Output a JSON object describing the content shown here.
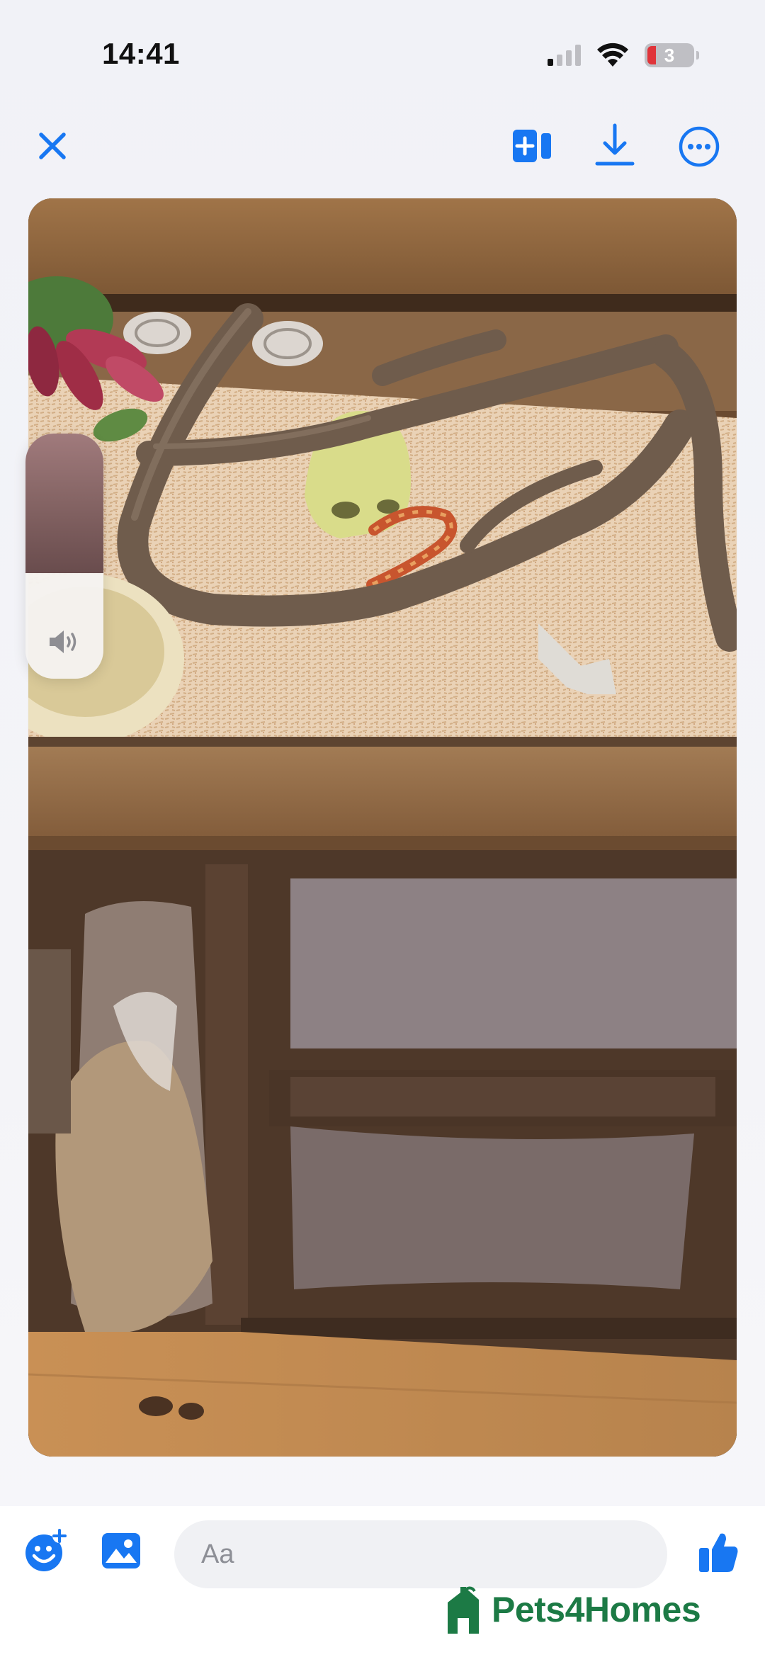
{
  "status_bar": {
    "time": "14:41",
    "battery_level": "3",
    "icons": [
      "cellular-signal-icon",
      "wifi-icon",
      "battery-icon"
    ]
  },
  "top_nav": {
    "icons": [
      "close-icon",
      "add-to-album-icon",
      "download-icon",
      "more-options-icon"
    ]
  },
  "media": {
    "volume_level": 0.57,
    "volume_icon": "speaker-icon"
  },
  "composer": {
    "placeholder": "Aa",
    "icons": [
      "add-emoji-effect-icon",
      "photo-library-icon",
      "thumbs-up-icon"
    ]
  },
  "watermark": {
    "text": "Pets4Homes"
  },
  "colors": {
    "accent": "#1877f2",
    "watermark": "#1c7a45",
    "background": "#f2f3f7"
  }
}
